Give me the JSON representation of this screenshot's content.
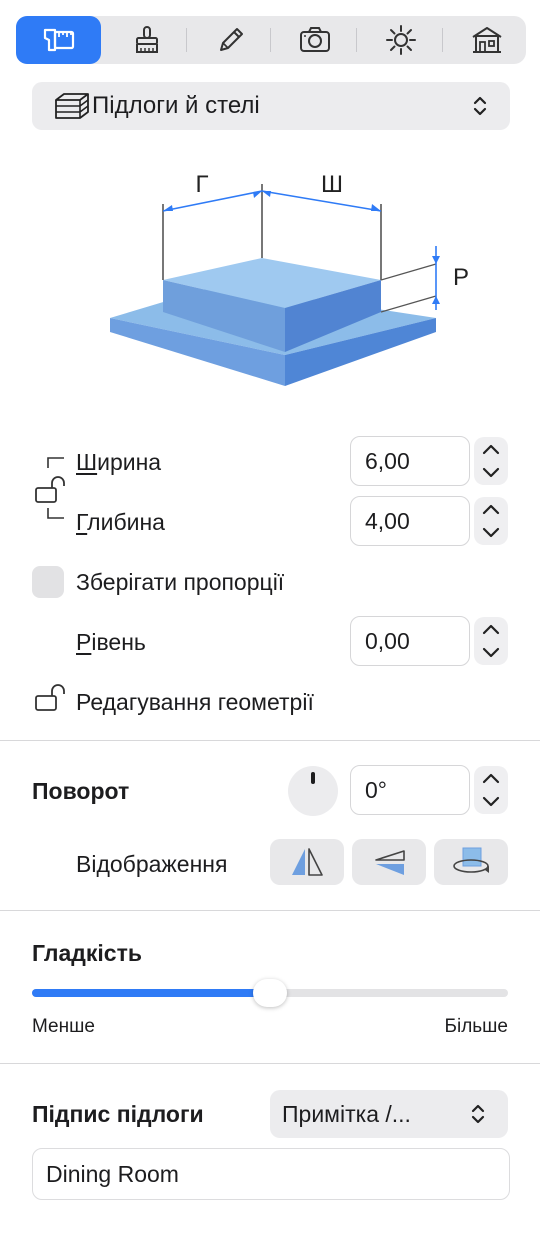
{
  "toolbar": {
    "buttons": [
      {
        "icon": "caliper-ruler-icon",
        "active": true
      },
      {
        "icon": "brush-stamp-icon",
        "active": false
      },
      {
        "icon": "pencil-icon",
        "active": false
      },
      {
        "icon": "camera-icon",
        "active": false
      },
      {
        "icon": "sun-icon",
        "active": false
      },
      {
        "icon": "house-icon",
        "active": false
      }
    ]
  },
  "object_type": {
    "selected": "Підлоги й стелі",
    "icon": "floor-slab-icon"
  },
  "diagram": {
    "width_letter": "Ш",
    "depth_letter": "Г",
    "level_letter": "Р"
  },
  "dimensions": {
    "width_label": "Ширина",
    "width_value": "6,00",
    "depth_label": "Глибина",
    "depth_value": "4,00",
    "keep_proportions_label": "Зберігати пропорції",
    "keep_proportions_checked": false,
    "level_label": "Рівень",
    "level_value": "0,00",
    "edit_geometry_label": "Редагування геометрії"
  },
  "rotation": {
    "title": "Поворот",
    "value": "0°",
    "mirror_label": "Відображення"
  },
  "smoothness": {
    "title": "Гладкість",
    "min_label": "Менше",
    "max_label": "Більше",
    "level": 0.5
  },
  "floor_label": {
    "title": "Підпис підлоги",
    "selected": "Примітка /...",
    "text": "Dining Room"
  },
  "colors": {
    "accent": "#2f7bf6",
    "slab_top": "#9fc9f0",
    "slab_side": "#5b8fd6"
  }
}
